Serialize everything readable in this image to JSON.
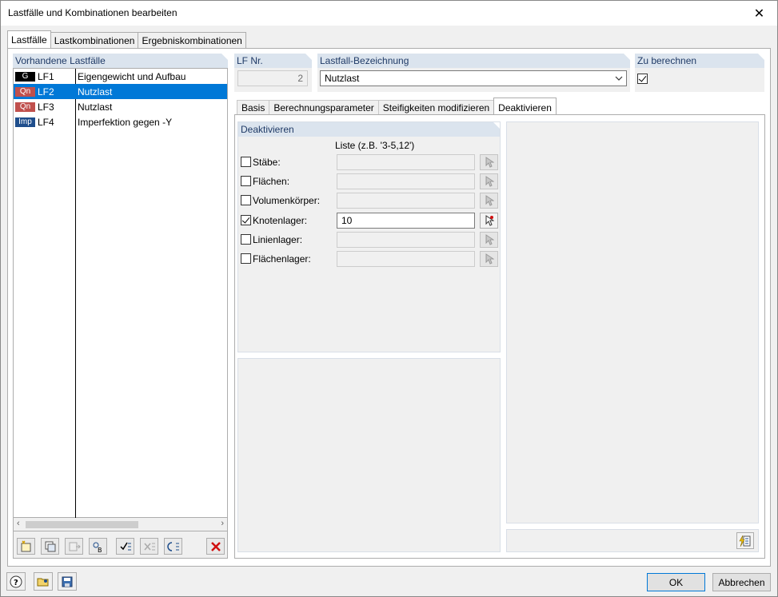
{
  "window": {
    "title": "Lastfälle und Kombinationen bearbeiten",
    "close_glyph": "✕"
  },
  "main_tabs": [
    "Lastfälle",
    "Lastkombinationen",
    "Ergebniskombinationen"
  ],
  "load_cases": {
    "header": "Vorhandene Lastfälle",
    "items": [
      {
        "badge": "G",
        "badge_color": "#000000",
        "no": "LF1",
        "name": "Eigengewicht und Aufbau"
      },
      {
        "badge": "Qn",
        "badge_color": "#c0504d",
        "no": "LF2",
        "name": "Nutzlast"
      },
      {
        "badge": "Qn",
        "badge_color": "#c0504d",
        "no": "LF3",
        "name": "Nutzlast"
      },
      {
        "badge": "Imp",
        "badge_color": "#1f4e8c",
        "no": "LF4",
        "name": "Imperfektion gegen -Y"
      }
    ],
    "selected_index": 1
  },
  "lf_nr": {
    "label": "LF Nr.",
    "value": "2"
  },
  "lf_name": {
    "label": "Lastfall-Bezeichnung",
    "value": "Nutzlast"
  },
  "to_calc": {
    "label": "Zu berechnen",
    "checked": true
  },
  "sub_tabs": [
    "Basis",
    "Berechnungsparameter",
    "Steifigkeiten modifizieren",
    "Deaktivieren"
  ],
  "deactivate": {
    "header": "Deaktivieren",
    "list_header": "Liste (z.B. '3-5,12')",
    "rows": [
      {
        "label": "Stäbe:",
        "checked": false,
        "value": ""
      },
      {
        "label": "Flächen:",
        "checked": false,
        "value": ""
      },
      {
        "label": "Volumenkörper:",
        "checked": false,
        "value": ""
      },
      {
        "label": "Knotenlager:",
        "checked": true,
        "value": "10"
      },
      {
        "label": "Linienlager:",
        "checked": false,
        "value": ""
      },
      {
        "label": "Flächenlager:",
        "checked": false,
        "value": ""
      }
    ]
  },
  "buttons": {
    "ok": "OK",
    "cancel": "Abbrechen"
  },
  "colors": {
    "accent": "#0078d7",
    "group_header_bg": "#dbe4ee",
    "group_header_fg": "#1f3a66"
  }
}
